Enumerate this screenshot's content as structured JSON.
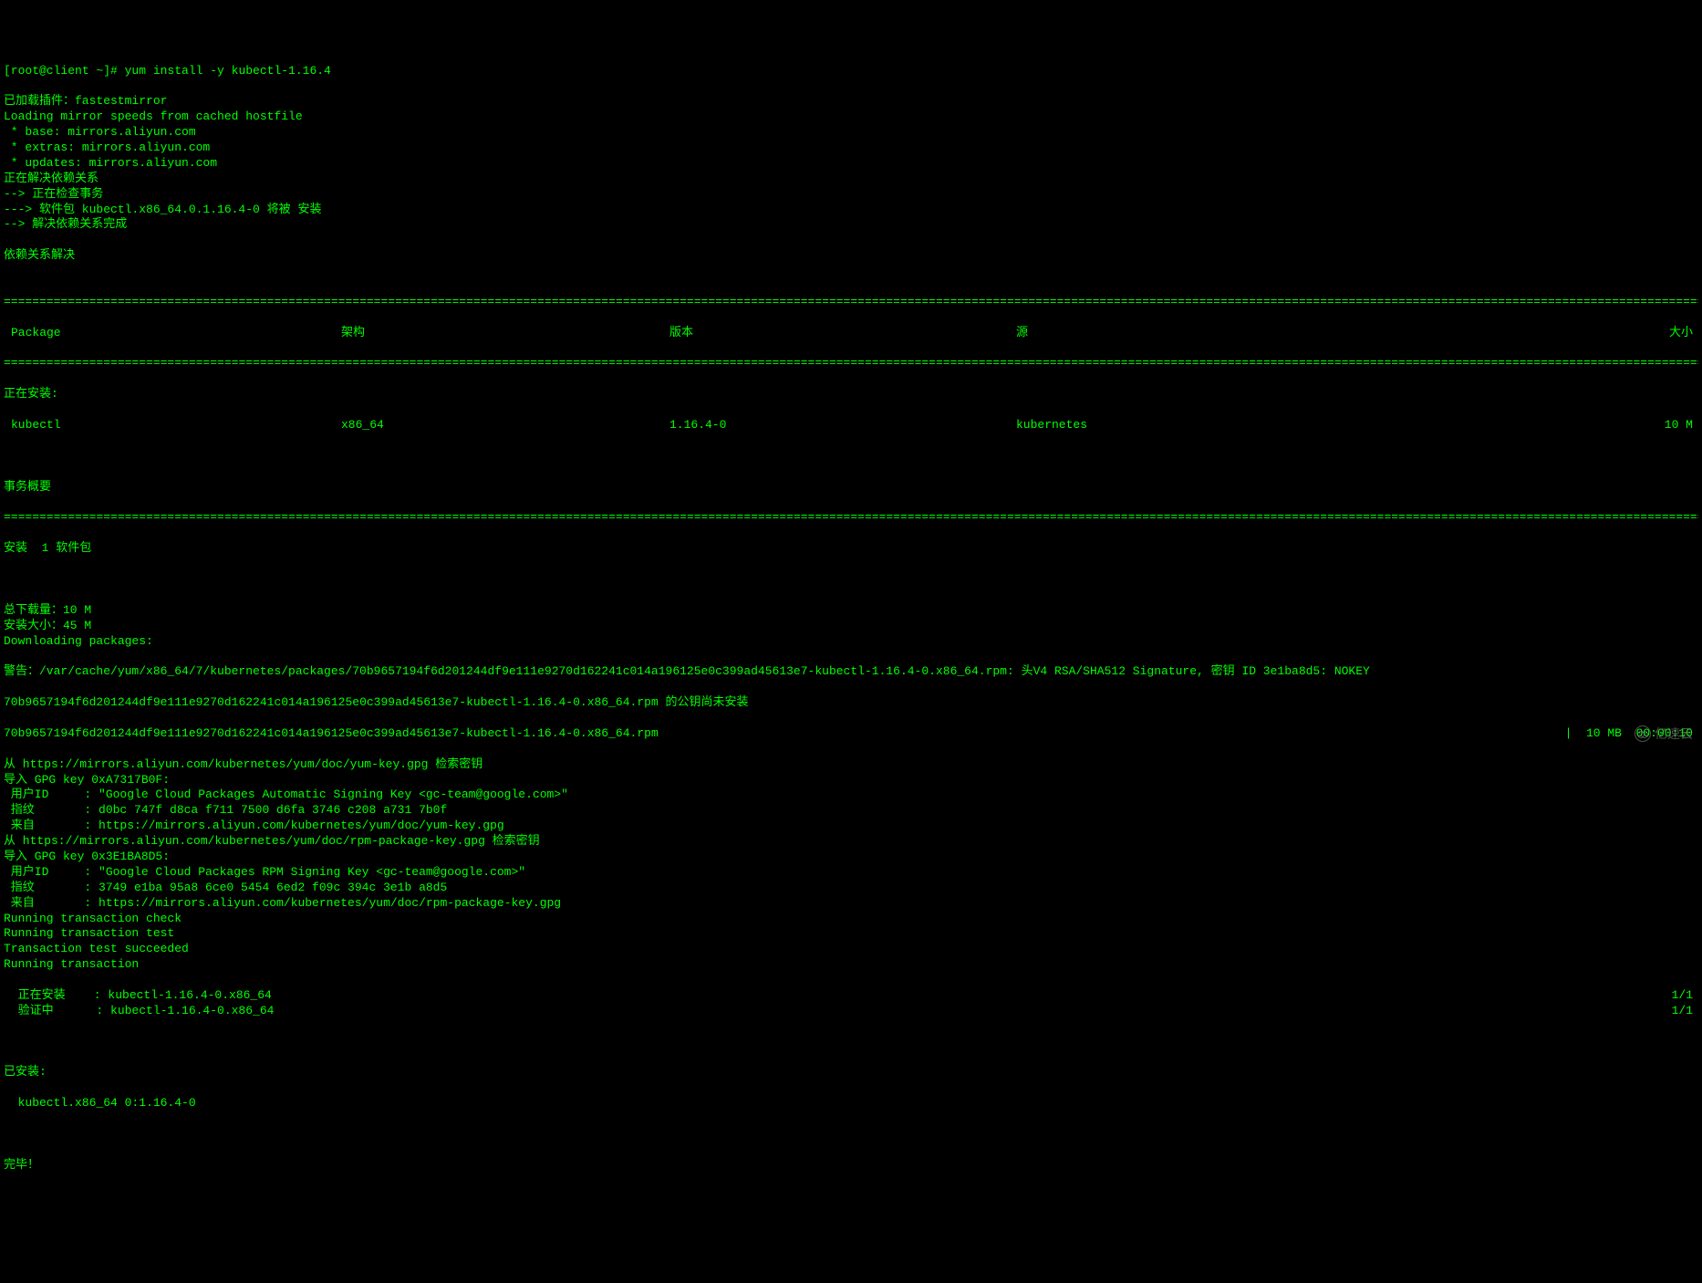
{
  "prompt": "[root@client ~]# yum install -y kubectl-1.16.4",
  "pre_lines": [
    "已加载插件：fastestmirror",
    "Loading mirror speeds from cached hostfile",
    " * base: mirrors.aliyun.com",
    " * extras: mirrors.aliyun.com",
    " * updates: mirrors.aliyun.com",
    "正在解决依赖关系",
    "--> 正在检查事务",
    "---> 软件包 kubectl.x86_64.0.1.16.4-0 将被 安装",
    "--> 解决依赖关系完成",
    "",
    "依赖关系解决",
    ""
  ],
  "divider": "================================================================================================================================================================================================================================================",
  "header": {
    "package": "Package",
    "arch": "架构",
    "version": "版本",
    "repo": "源",
    "size": "大小"
  },
  "installing_label": "正在安装:",
  "pkg_row": {
    "package": "kubectl",
    "arch": "x86_64",
    "version": "1.16.4-0",
    "repo": "kubernetes",
    "size": "10 M"
  },
  "summary_label": "事务概要",
  "install_count": "安装  1 软件包",
  "totals": [
    "总下载量：10 M",
    "安装大小：45 M",
    "Downloading packages:"
  ],
  "warning_line": "警告：/var/cache/yum/x86_64/7/kubernetes/packages/70b9657194f6d201244df9e111e9270d162241c014a196125e0c399ad45613e7-kubectl-1.16.4-0.x86_64.rpm: 头V4 RSA/SHA512 Signature, 密钥 ID 3e1ba8d5: NOKEY",
  "pubkey_line": "70b9657194f6d201244df9e111e9270d162241c014a196125e0c399ad45613e7-kubectl-1.16.4-0.x86_64.rpm 的公钥尚未安装",
  "dl_line_left": "70b9657194f6d201244df9e111e9270d162241c014a196125e0c399ad45613e7-kubectl-1.16.4-0.x86_64.rpm",
  "dl_line_right": "|  10 MB  00:00:10",
  "gpg_lines": [
    "从 https://mirrors.aliyun.com/kubernetes/yum/doc/yum-key.gpg 检索密钥",
    "导入 GPG key 0xA7317B0F:",
    " 用户ID     : \"Google Cloud Packages Automatic Signing Key <gc-team@google.com>\"",
    " 指纹       : d0bc 747f d8ca f711 7500 d6fa 3746 c208 a731 7b0f",
    " 来自       : https://mirrors.aliyun.com/kubernetes/yum/doc/yum-key.gpg",
    "从 https://mirrors.aliyun.com/kubernetes/yum/doc/rpm-package-key.gpg 检索密钥",
    "导入 GPG key 0x3E1BA8D5:",
    " 用户ID     : \"Google Cloud Packages RPM Signing Key <gc-team@google.com>\"",
    " 指纹       : 3749 e1ba 95a8 6ce0 5454 6ed2 f09c 394c 3e1b a8d5",
    " 来自       : https://mirrors.aliyun.com/kubernetes/yum/doc/rpm-package-key.gpg",
    "Running transaction check",
    "Running transaction test",
    "Transaction test succeeded",
    "Running transaction"
  ],
  "install_steps": [
    {
      "left": "  正在安装    : kubectl-1.16.4-0.x86_64",
      "right": "1/1"
    },
    {
      "left": "  验证中      : kubectl-1.16.4-0.x86_64",
      "right": "1/1"
    }
  ],
  "installed_label": "已安装:",
  "installed_pkg": "  kubectl.x86_64 0:1.16.4-0",
  "done": "完毕！",
  "watermark": "亿速云"
}
